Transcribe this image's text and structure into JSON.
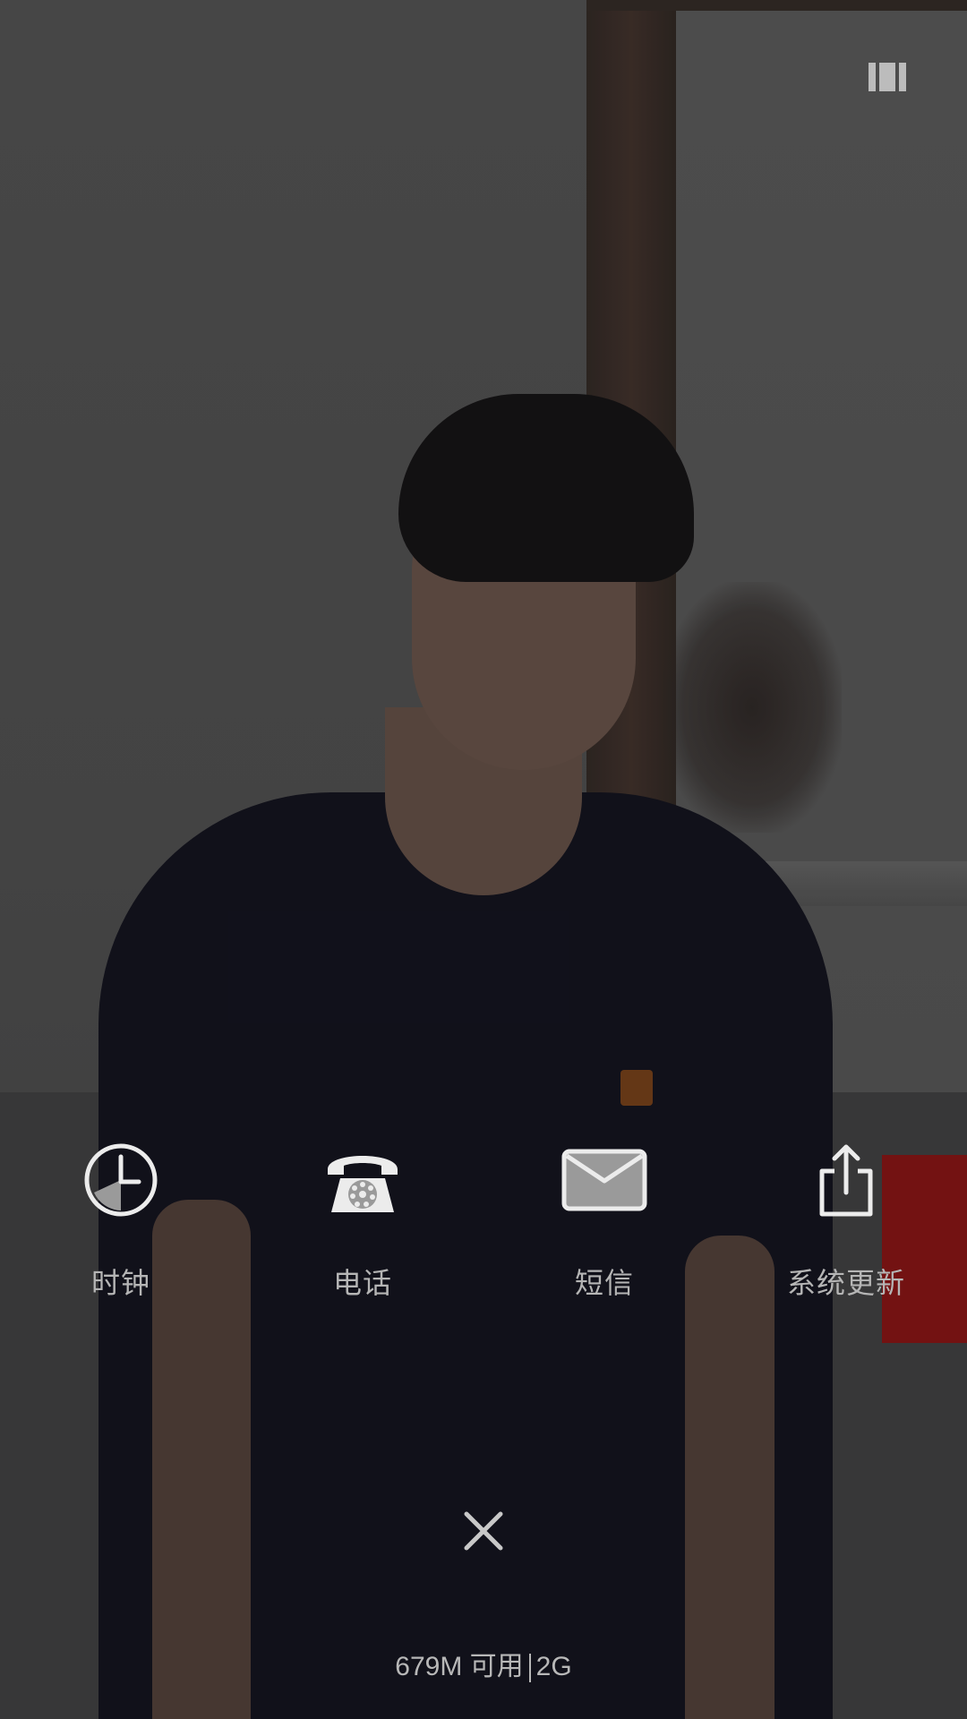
{
  "apps": [
    {
      "label": "时钟",
      "icon": "clock-icon"
    },
    {
      "label": "电话",
      "icon": "telephone-icon"
    },
    {
      "label": "短信",
      "icon": "envelope-icon"
    },
    {
      "label": "系统更新",
      "icon": "share-upload-icon"
    }
  ],
  "memory": {
    "available": "679M 可用",
    "total": "2G"
  },
  "icons": {
    "top_right": "view-mode-icon",
    "close": "close-icon"
  },
  "colors": {
    "icon": "#e6e6e6",
    "label": "#b5b5b5"
  }
}
